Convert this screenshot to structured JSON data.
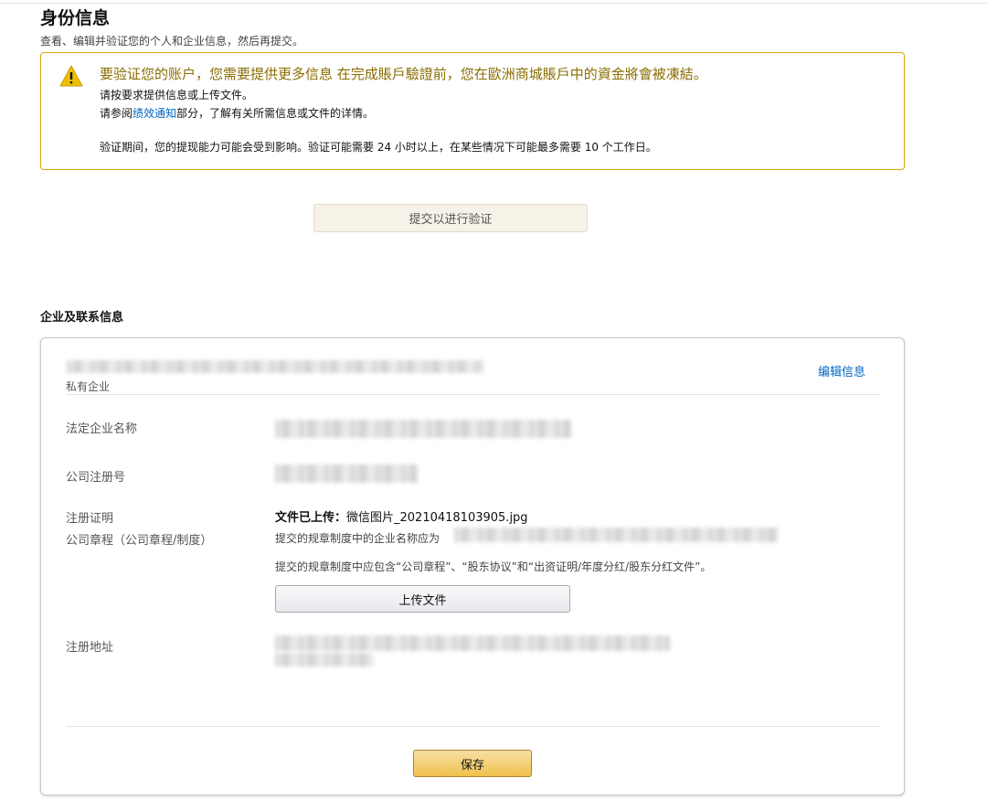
{
  "page": {
    "title": "身份信息",
    "subtitle": "查看、编辑并验证您的个人和企业信息，然后再提交。"
  },
  "alert": {
    "icon": "warning-icon",
    "heading": "要验证您的账户，您需要提供更多信息 在完成賬戶驗證前，您在歐洲商城賬戶中的資金將會被凍結。",
    "line1": "请按要求提供信息或上传文件。",
    "line2_prefix": "请参阅",
    "line2_link": "绩效通知",
    "line2_suffix": "部分，了解有关所需信息或文件的详情。",
    "line3": "验证期间，您的提现能力可能会受到影响。验证可能需要 24 小时以上，在某些情况下可能最多需要 10 个工作日。"
  },
  "submit_verify_label": "提交以进行验证",
  "section": {
    "title": "企业及联系信息"
  },
  "card": {
    "business_type": "私有企业",
    "edit_label": "编辑信息",
    "fields": {
      "legal_name_label": "法定企业名称",
      "reg_number_label": "公司注册号",
      "reg_proof_label": "注册证明",
      "articles_label": "公司章程（公司章程/制度）",
      "address_label": "注册地址"
    },
    "upload_status_prefix": "文件已上传：",
    "upload_filename": "微信图片_20210418103905.jpg",
    "req_name_prefix": "提交的规章制度中的企业名称应为",
    "req_docs": "提交的规章制度中应包含“公司章程”、“股东协议”和“出资证明/年度分红/股东分红文件”。",
    "upload_label": "上传文件",
    "save_label": "保存"
  },
  "colors": {
    "alert_border": "#d6a900",
    "alert_heading": "#8a6d00",
    "link": "#0066c0",
    "save_button": "#f0c14b"
  }
}
